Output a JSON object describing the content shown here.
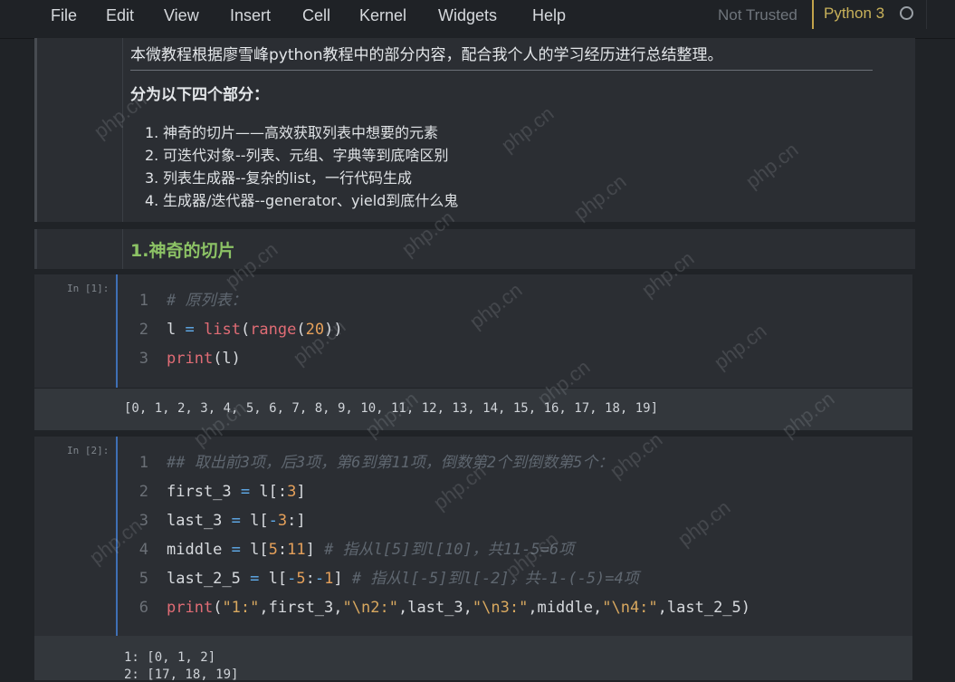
{
  "menu": [
    "File",
    "Edit",
    "View",
    "Insert",
    "Cell",
    "Kernel",
    "Widgets",
    "Help"
  ],
  "trust_status": "Not Trusted",
  "kernel_name": "Python 3",
  "intro": {
    "text": "本微教程根据廖雪峰python教程中的部分内容，配合我个人的学习经历进行总结整理。",
    "section_heading": "分为以下四个部分：",
    "items": [
      {
        "num": "1.",
        "text": "神奇的切片——高效获取列表中想要的元素"
      },
      {
        "num": "2.",
        "text": "可迭代对象--列表、元组、字典等到底啥区别"
      },
      {
        "num": "3.",
        "text": "列表生成器--复杂的list，一行代码生成"
      },
      {
        "num": "4.",
        "text": "生成器/迭代器--generator、yield到底什么鬼"
      }
    ]
  },
  "heading1": "1.神奇的切片",
  "cell1": {
    "prompt": "In [1]:",
    "line_numbers": [
      "1",
      "2",
      "3"
    ],
    "output": "[0, 1, 2, 3, 4, 5, 6, 7, 8, 9, 10, 11, 12, 13, 14, 15, 16, 17, 18, 19]"
  },
  "cell2": {
    "prompt": "In [2]:",
    "line_numbers": [
      "1",
      "2",
      "3",
      "4",
      "5",
      "6"
    ],
    "output": [
      "1: [0, 1, 2]",
      "2: [17, 18, 19]"
    ]
  },
  "watermark": "php.cn"
}
